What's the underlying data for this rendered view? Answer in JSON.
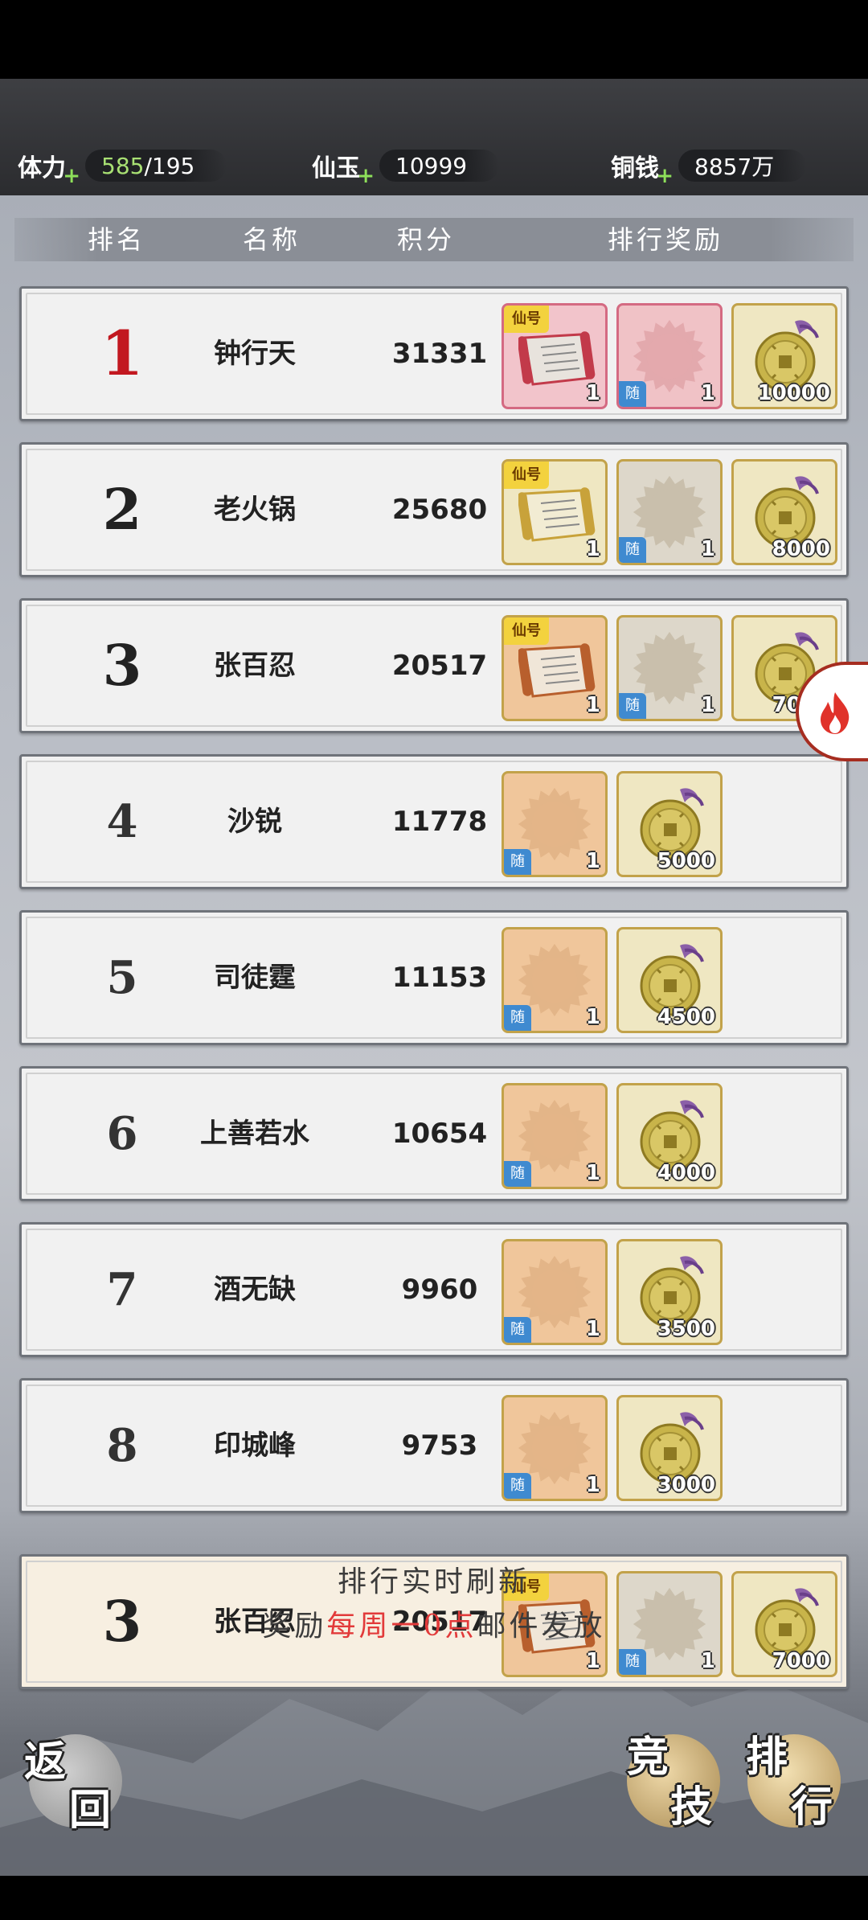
{
  "stats": {
    "stamina_label": "体力",
    "stamina_current": "585",
    "stamina_max": "/195",
    "jade_label": "仙玉",
    "jade_value": "10999",
    "copper_label": "铜钱",
    "copper_value": "8857万",
    "plus": "+"
  },
  "table_header": {
    "rank": "排名",
    "name": "名称",
    "score": "积分",
    "reward": "排行奖励"
  },
  "tags": {
    "title_tag": "仙号",
    "random_tag": "随"
  },
  "rows": [
    {
      "rank": "1",
      "name": "钟行天",
      "score": "31331",
      "items": [
        {
          "kind": "scroll",
          "color": "pink",
          "qty": "1",
          "tag": "仙号"
        },
        {
          "kind": "random",
          "color": "pinkgray",
          "qty": "1",
          "tag": "随"
        },
        {
          "kind": "coin",
          "color": "yellowbg",
          "qty": "10000"
        }
      ]
    },
    {
      "rank": "2",
      "name": "老火锅",
      "score": "25680",
      "items": [
        {
          "kind": "scroll",
          "color": "yellowbg",
          "qty": "1",
          "tag": "仙号"
        },
        {
          "kind": "random",
          "color": "gray",
          "qty": "1",
          "tag": "随"
        },
        {
          "kind": "coin",
          "color": "yellowbg",
          "qty": "8000"
        }
      ]
    },
    {
      "rank": "3",
      "name": "张百忍",
      "score": "20517",
      "items": [
        {
          "kind": "scroll",
          "color": "orange",
          "qty": "1",
          "tag": "仙号"
        },
        {
          "kind": "random",
          "color": "gray",
          "qty": "1",
          "tag": "随"
        },
        {
          "kind": "coin",
          "color": "yellowbg",
          "qty": "7000"
        }
      ]
    },
    {
      "rank": "4",
      "name": "沙锐",
      "score": "11778",
      "items": [
        {
          "kind": "random",
          "color": "orange",
          "qty": "1",
          "tag": "随"
        },
        {
          "kind": "coin",
          "color": "yellowbg",
          "qty": "5000"
        }
      ]
    },
    {
      "rank": "5",
      "name": "司徒霆",
      "score": "11153",
      "items": [
        {
          "kind": "random",
          "color": "orange",
          "qty": "1",
          "tag": "随"
        },
        {
          "kind": "coin",
          "color": "yellowbg",
          "qty": "4500"
        }
      ]
    },
    {
      "rank": "6",
      "name": "上善若水",
      "score": "10654",
      "items": [
        {
          "kind": "random",
          "color": "orange",
          "qty": "1",
          "tag": "随"
        },
        {
          "kind": "coin",
          "color": "yellowbg",
          "qty": "4000"
        }
      ]
    },
    {
      "rank": "7",
      "name": "酒无缺",
      "score": "9960",
      "items": [
        {
          "kind": "random",
          "color": "orange",
          "qty": "1",
          "tag": "随"
        },
        {
          "kind": "coin",
          "color": "yellowbg",
          "qty": "3500"
        }
      ]
    },
    {
      "rank": "8",
      "name": "印城峰",
      "score": "9753",
      "items": [
        {
          "kind": "random",
          "color": "orange",
          "qty": "1",
          "tag": "随"
        },
        {
          "kind": "coin",
          "color": "yellowbg",
          "qty": "3000"
        }
      ]
    }
  ],
  "self_row": {
    "rank": "3",
    "name": "张百忍",
    "score": "20517",
    "items": [
      {
        "kind": "scroll",
        "color": "orange",
        "qty": "1",
        "tag": "仙号"
      },
      {
        "kind": "random",
        "color": "gray",
        "qty": "1",
        "tag": "随"
      },
      {
        "kind": "coin",
        "color": "yellowbg",
        "qty": "7000"
      }
    ]
  },
  "footer": {
    "line1": "排行实时刷新",
    "line2_pre": "奖励",
    "line2_red": "每周一0点",
    "line2_post": "邮件发放",
    "back_chars": [
      "返",
      "回"
    ],
    "arena_chars": [
      "竞",
      "技"
    ],
    "ranking_chars": [
      "排",
      "行"
    ]
  },
  "colors": {
    "accent_red": "#e23a3a",
    "plus_green": "#8ee05a",
    "rank1_red": "#c21820"
  },
  "icons": {
    "side_button": "fire-icon"
  }
}
